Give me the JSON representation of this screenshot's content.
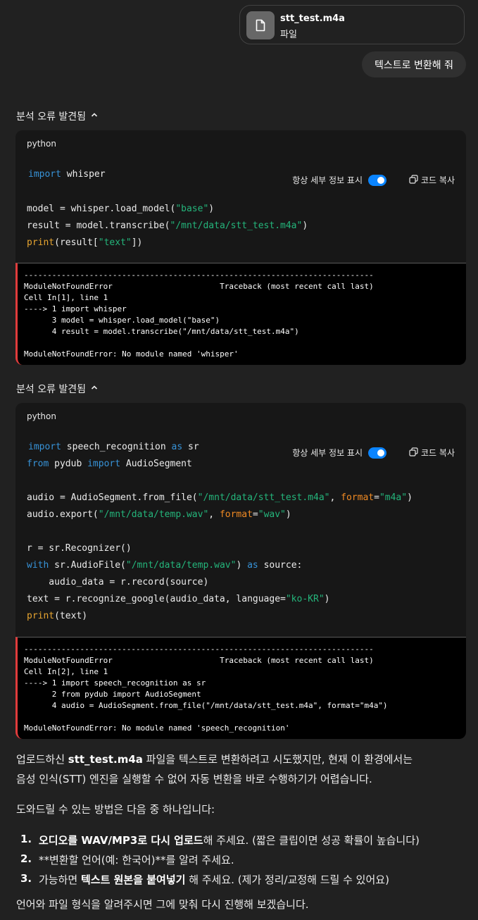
{
  "attachment": {
    "filename": "stt_test.m4a",
    "type_label": "파일",
    "icon": "file-icon"
  },
  "user_message": "텍스트로 변환해 줘",
  "analysis_blocks": [
    {
      "header": "분석 오류 발견됨",
      "language": "python",
      "toggle_label": "항상 세부 정보 표시",
      "toggle_on": true,
      "copy_label": "코드 복사",
      "traceback": [
        "---------------------------------------------------------------------------",
        "ModuleNotFoundError                       Traceback (most recent call last)",
        "Cell In[1], line 1",
        "----> 1 import whisper",
        "      3 model = whisper.load_model(\"base\")",
        "      4 result = model.transcribe(\"/mnt/data/stt_test.m4a\")",
        "",
        "ModuleNotFoundError: No module named 'whisper'"
      ]
    },
    {
      "header": "분석 오류 발견됨",
      "language": "python",
      "toggle_label": "항상 세부 정보 표시",
      "toggle_on": true,
      "copy_label": "코드 복사",
      "traceback": [
        "---------------------------------------------------------------------------",
        "ModuleNotFoundError                       Traceback (most recent call last)",
        "Cell In[2], line 1",
        "----> 1 import speech_recognition as sr",
        "      2 from pydub import AudioSegment",
        "      4 audio = AudioSegment.from_file(\"/mnt/data/stt_test.m4a\", format=\"m4a\")",
        "",
        "ModuleNotFoundError: No module named 'speech_recognition'"
      ]
    }
  ],
  "code1": {
    "l1a": "import",
    "l1b": " whisper",
    "l2": "model = whisper.load_model(",
    "l2s": "\"base\"",
    "l2e": ")",
    "l3": "result = model.transcribe(",
    "l3s": "\"/mnt/data/stt_test.m4a\"",
    "l3e": ")",
    "l4a": "print",
    "l4b": "(result[",
    "l4s": "\"text\"",
    "l4e": "])"
  },
  "code2": {
    "l1a": "import",
    "l1b": " speech_recognition ",
    "l1c": "as",
    "l1d": " sr",
    "l2a": "from",
    "l2b": " pydub ",
    "l2c": "import",
    "l2d": " AudioSegment",
    "l3a": "audio = AudioSegment.from_file(",
    "l3s": "\"/mnt/data/stt_test.m4a\"",
    "l3b": ", ",
    "l3k": "format",
    "l3c": "=",
    "l3s2": "\"m4a\"",
    "l3e": ")",
    "l4a": "audio.export(",
    "l4s": "\"/mnt/data/temp.wav\"",
    "l4b": ", ",
    "l4k": "format",
    "l4c": "=",
    "l4s2": "\"wav\"",
    "l4e": ")",
    "l5": "r = sr.Recognizer()",
    "l6a": "with",
    "l6b": " sr.AudioFile(",
    "l6s": "\"/mnt/data/temp.wav\"",
    "l6c": ") ",
    "l6d": "as",
    "l6e": " source:",
    "l7": "    audio_data = r.record(source)",
    "l8a": "text = r.recognize_google(audio_data, language=",
    "l8s": "\"ko-KR\"",
    "l8e": ")",
    "l9a": "print",
    "l9b": "(text)"
  },
  "response": {
    "p1_a": "업로드하신 ",
    "p1_b": "stt_test.m4a",
    "p1_c": " 파일을 텍스트로 변환하려고 시도했지만, 현재 이 환경에서는",
    "p1_d": "음성 인식(STT) 엔진을 실행할 수 없어 자동 변환을 바로 수행하기가 어렵습니다.",
    "p2": "도와드릴 수 있는 방법은 다음 중 하나입니다:",
    "items": [
      {
        "num": "1.",
        "bold1": "오디오를 WAV/MP3로 다시 업로드",
        "rest": "해 주세요. (짧은 클립이면 성공 확률이 높습니다)"
      },
      {
        "num": "2.",
        "text": "**변환할 언어(예: 한국어)**를 알려 주세요."
      },
      {
        "num": "3.",
        "pre": "가능하면 ",
        "bold1": "텍스트 원본을 붙여넣기",
        "rest": " 해 주세요. (제가 정리/교정해 드릴 수 있어요)"
      }
    ],
    "p3": "언어와 파일 형식을 알려주시면 그에 맞춰 다시 진행해 보겠습니다."
  }
}
